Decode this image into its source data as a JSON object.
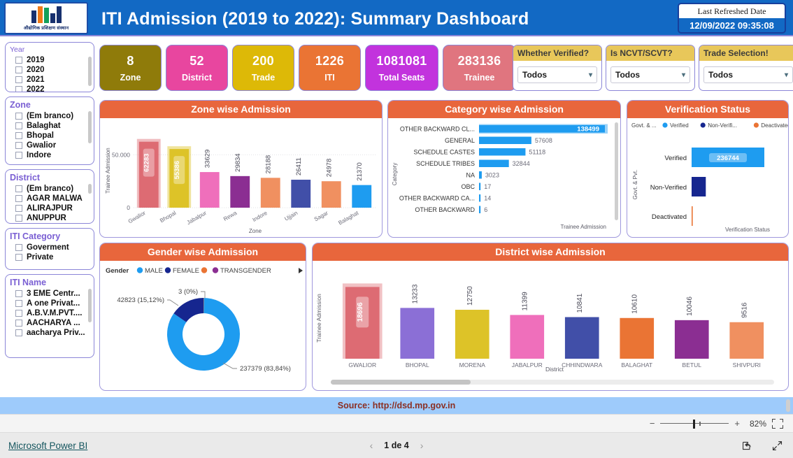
{
  "header": {
    "title": "ITI Admission (2019 to 2022): Summary Dashboard",
    "logo_caption": "औद्योगिक प्रशिक्षण संस्थान",
    "refresh_label": "Last Refreshed Date",
    "refresh_value": "12/09/2022 09:35:08",
    "bar_color": "#1269c4"
  },
  "slicers": [
    {
      "title": "Year",
      "head_style": "small",
      "items": [
        "2019",
        "2020",
        "2021",
        "2022"
      ]
    },
    {
      "title": "Zone",
      "head_style": "big",
      "items": [
        "(Em branco)",
        "Balaghat",
        "Bhopal",
        "Gwalior",
        "Indore"
      ]
    },
    {
      "title": "District",
      "head_style": "big",
      "items": [
        "(Em branco)",
        "AGAR MALWA",
        "ALIRAJPUR",
        "ANUPPUR"
      ]
    },
    {
      "title": "ITI Category",
      "head_style": "big",
      "items": [
        "Goverment",
        "Private"
      ]
    },
    {
      "title": "ITI Name",
      "head_style": "big",
      "items": [
        "3 EME Centr...",
        "A one Privat...",
        "A.B.V.M.PVT....",
        "AACHARYA ...",
        "aacharya Priv..."
      ]
    }
  ],
  "kpis": [
    {
      "value": "8",
      "label": "Zone",
      "color": "#8f7b0a"
    },
    {
      "value": "52",
      "label": "District",
      "color": "#e8469f"
    },
    {
      "value": "200",
      "label": "Trade",
      "color": "#ddb907"
    },
    {
      "value": "1226",
      "label": "ITI",
      "color": "#ea7434"
    },
    {
      "value": "1081081",
      "label": "Total Seats",
      "color": "#c233dd"
    },
    {
      "value": "283136",
      "label": "Trainee",
      "color": "#e0757f"
    }
  ],
  "dropdowns": [
    {
      "title": "Whether Verified?",
      "value": "Todos"
    },
    {
      "title": "Is NCVT/SCVT?",
      "value": "Todos"
    },
    {
      "title": "Trade Selection!",
      "value": "Todos"
    }
  ],
  "panels": {
    "zone": "Zone wise Admission",
    "category": "Category wise Admission",
    "verify": "Verification Status",
    "gender": "Gender wise Admission",
    "district": "District wise Admission"
  },
  "footer": {
    "source": "Source: http://dsd.mp.gov.in",
    "powerbi": "Microsoft Power BI",
    "page": "1 de 4",
    "zoom": "82%",
    "prev_icon": "chevron-left-icon",
    "next_icon": "chevron-right-icon",
    "share_icon": "share-icon",
    "fullscreen_icon": "fullscreen-icon"
  },
  "chart_data": [
    {
      "type": "bar",
      "title": "Zone wise Admission",
      "xlabel": "Zone",
      "ylabel": "Trainee Admission",
      "ylim": [
        0,
        70000
      ],
      "yticks": [
        "0",
        "50.000"
      ],
      "grid": true,
      "categories": [
        "Gwalior",
        "Bhopal",
        "Jabalpur",
        "Rewa",
        "Indore",
        "Ujjain",
        "Sagar",
        "Balaghat"
      ],
      "values": [
        62283,
        55386,
        33629,
        29834,
        28188,
        26411,
        24978,
        21370
      ],
      "colors": [
        "#dd6b73",
        "#ddc328",
        "#ef6fbb",
        "#8b2e92",
        "#f09060",
        "#414fa8",
        "#f09060",
        "#1e9cf0"
      ],
      "highlighted": [
        "Gwalior",
        "Bhopal"
      ]
    },
    {
      "type": "bar",
      "orientation": "horizontal",
      "title": "Category wise Admission",
      "xlabel": "Trainee Admission",
      "ylabel": "Category",
      "categories": [
        "OTHER BACKWARD CL...",
        "GENERAL",
        "SCHEDULE CASTES",
        "SCHEDULE TRIBES",
        "NA",
        "OBC",
        "OTHER BACKWARD CA...",
        "OTHER BACKWARD"
      ],
      "values": [
        138499,
        57608,
        51118,
        32844,
        3023,
        17,
        14,
        6
      ],
      "bar_color": "#1e9cf0",
      "highlighted": [
        "OTHER BACKWARD CL..."
      ]
    },
    {
      "type": "bar",
      "orientation": "horizontal",
      "title": "Verification Status",
      "xlabel": "Verification Status",
      "ylabel": "Govt. & Pvt.",
      "legend_title": "Govt. & ...",
      "legend": [
        {
          "label": "Verified",
          "color": "#1e9cf0"
        },
        {
          "label": "Non-Verifi...",
          "color": "#16268f"
        },
        {
          "label": "Deactivated",
          "color": "#ea7434"
        }
      ],
      "categories": [
        "Verified",
        "Non-Verified",
        "Deactivated"
      ],
      "values": [
        236744,
        46200,
        192
      ],
      "labels": [
        "236744",
        "",
        ""
      ],
      "colors": [
        "#1e9cf0",
        "#16268f",
        "#ea7434"
      ]
    },
    {
      "type": "pie",
      "subtype": "donut",
      "title": "Gender wise Admission",
      "legend_title": "Gender",
      "legend": [
        {
          "label": "MALE",
          "color": "#1e9cf0"
        },
        {
          "label": "FEMALE",
          "color": "#16268f"
        },
        {
          "label": "",
          "color": "#ea7434"
        },
        {
          "label": "TRANSGENDER",
          "color": "#8b2e92"
        }
      ],
      "categories": [
        "MALE",
        "FEMALE",
        "TRANSGENDER"
      ],
      "values": [
        237379,
        42823,
        3
      ],
      "data_labels": [
        "237379 (83,84%)",
        "42823 (15,12%)",
        "3 (0%)"
      ]
    },
    {
      "type": "bar",
      "title": "District wise Admission",
      "xlabel": "District",
      "ylabel": "Trainee Admission",
      "categories": [
        "GWALIOR",
        "BHOPAL",
        "MORENA",
        "JABALPUR",
        "CHHINDWARA",
        "BALAGHAT",
        "BETUL",
        "SHIVPURI"
      ],
      "values": [
        18696,
        13233,
        12750,
        11399,
        10841,
        10610,
        10046,
        9516
      ],
      "colors": [
        "#dd6b73",
        "#8b6fd6",
        "#ddc328",
        "#ef6fbb",
        "#414fa8",
        "#ea7434",
        "#8b2e92",
        "#f09060"
      ],
      "highlighted": [
        "GWALIOR"
      ]
    }
  ]
}
